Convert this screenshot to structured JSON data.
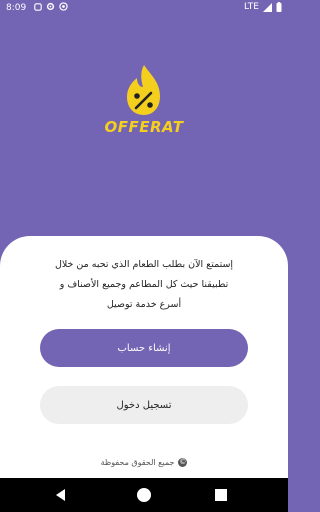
{
  "status_bar": {
    "time": "8:09",
    "icons": [
      "settings-icon",
      "gear-icon",
      "at-icon"
    ],
    "network": "LTE",
    "signal_icon": "signal-icon",
    "battery_icon": "battery-icon"
  },
  "brand": {
    "name": "OFFERAT",
    "logo_icon": "fire-percent-icon",
    "logo_color": "#f5cf1e",
    "background_color": "#7464b4"
  },
  "welcome": {
    "line1": "إستمتع الآن بطلب الطعام الذي تحبه من خلال",
    "line2": "تطبيقنا حيث كل المطاعم وجميع الأصناف و",
    "line3": "أسرع خدمة توصيل"
  },
  "buttons": {
    "create_account": "إنشاء حساب",
    "login": "تسجيل دخول"
  },
  "footer": {
    "rights": "جميع الحقوق محفوظة",
    "copyright_symbol": "©"
  },
  "nav": {
    "back_icon": "back-icon",
    "home_icon": "home-icon",
    "recents_icon": "recents-icon"
  }
}
